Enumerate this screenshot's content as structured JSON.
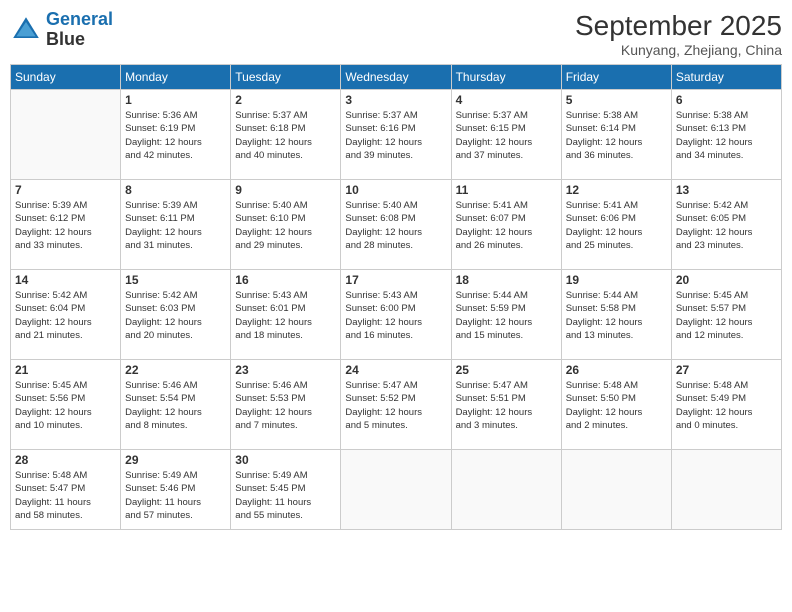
{
  "logo": {
    "line1": "General",
    "line2": "Blue"
  },
  "title": "September 2025",
  "subtitle": "Kunyang, Zhejiang, China",
  "weekdays": [
    "Sunday",
    "Monday",
    "Tuesday",
    "Wednesday",
    "Thursday",
    "Friday",
    "Saturday"
  ],
  "weeks": [
    [
      {
        "day": "",
        "info": ""
      },
      {
        "day": "1",
        "info": "Sunrise: 5:36 AM\nSunset: 6:19 PM\nDaylight: 12 hours\nand 42 minutes."
      },
      {
        "day": "2",
        "info": "Sunrise: 5:37 AM\nSunset: 6:18 PM\nDaylight: 12 hours\nand 40 minutes."
      },
      {
        "day": "3",
        "info": "Sunrise: 5:37 AM\nSunset: 6:16 PM\nDaylight: 12 hours\nand 39 minutes."
      },
      {
        "day": "4",
        "info": "Sunrise: 5:37 AM\nSunset: 6:15 PM\nDaylight: 12 hours\nand 37 minutes."
      },
      {
        "day": "5",
        "info": "Sunrise: 5:38 AM\nSunset: 6:14 PM\nDaylight: 12 hours\nand 36 minutes."
      },
      {
        "day": "6",
        "info": "Sunrise: 5:38 AM\nSunset: 6:13 PM\nDaylight: 12 hours\nand 34 minutes."
      }
    ],
    [
      {
        "day": "7",
        "info": "Sunrise: 5:39 AM\nSunset: 6:12 PM\nDaylight: 12 hours\nand 33 minutes."
      },
      {
        "day": "8",
        "info": "Sunrise: 5:39 AM\nSunset: 6:11 PM\nDaylight: 12 hours\nand 31 minutes."
      },
      {
        "day": "9",
        "info": "Sunrise: 5:40 AM\nSunset: 6:10 PM\nDaylight: 12 hours\nand 29 minutes."
      },
      {
        "day": "10",
        "info": "Sunrise: 5:40 AM\nSunset: 6:08 PM\nDaylight: 12 hours\nand 28 minutes."
      },
      {
        "day": "11",
        "info": "Sunrise: 5:41 AM\nSunset: 6:07 PM\nDaylight: 12 hours\nand 26 minutes."
      },
      {
        "day": "12",
        "info": "Sunrise: 5:41 AM\nSunset: 6:06 PM\nDaylight: 12 hours\nand 25 minutes."
      },
      {
        "day": "13",
        "info": "Sunrise: 5:42 AM\nSunset: 6:05 PM\nDaylight: 12 hours\nand 23 minutes."
      }
    ],
    [
      {
        "day": "14",
        "info": "Sunrise: 5:42 AM\nSunset: 6:04 PM\nDaylight: 12 hours\nand 21 minutes."
      },
      {
        "day": "15",
        "info": "Sunrise: 5:42 AM\nSunset: 6:03 PM\nDaylight: 12 hours\nand 20 minutes."
      },
      {
        "day": "16",
        "info": "Sunrise: 5:43 AM\nSunset: 6:01 PM\nDaylight: 12 hours\nand 18 minutes."
      },
      {
        "day": "17",
        "info": "Sunrise: 5:43 AM\nSunset: 6:00 PM\nDaylight: 12 hours\nand 16 minutes."
      },
      {
        "day": "18",
        "info": "Sunrise: 5:44 AM\nSunset: 5:59 PM\nDaylight: 12 hours\nand 15 minutes."
      },
      {
        "day": "19",
        "info": "Sunrise: 5:44 AM\nSunset: 5:58 PM\nDaylight: 12 hours\nand 13 minutes."
      },
      {
        "day": "20",
        "info": "Sunrise: 5:45 AM\nSunset: 5:57 PM\nDaylight: 12 hours\nand 12 minutes."
      }
    ],
    [
      {
        "day": "21",
        "info": "Sunrise: 5:45 AM\nSunset: 5:56 PM\nDaylight: 12 hours\nand 10 minutes."
      },
      {
        "day": "22",
        "info": "Sunrise: 5:46 AM\nSunset: 5:54 PM\nDaylight: 12 hours\nand 8 minutes."
      },
      {
        "day": "23",
        "info": "Sunrise: 5:46 AM\nSunset: 5:53 PM\nDaylight: 12 hours\nand 7 minutes."
      },
      {
        "day": "24",
        "info": "Sunrise: 5:47 AM\nSunset: 5:52 PM\nDaylight: 12 hours\nand 5 minutes."
      },
      {
        "day": "25",
        "info": "Sunrise: 5:47 AM\nSunset: 5:51 PM\nDaylight: 12 hours\nand 3 minutes."
      },
      {
        "day": "26",
        "info": "Sunrise: 5:48 AM\nSunset: 5:50 PM\nDaylight: 12 hours\nand 2 minutes."
      },
      {
        "day": "27",
        "info": "Sunrise: 5:48 AM\nSunset: 5:49 PM\nDaylight: 12 hours\nand 0 minutes."
      }
    ],
    [
      {
        "day": "28",
        "info": "Sunrise: 5:48 AM\nSunset: 5:47 PM\nDaylight: 11 hours\nand 58 minutes."
      },
      {
        "day": "29",
        "info": "Sunrise: 5:49 AM\nSunset: 5:46 PM\nDaylight: 11 hours\nand 57 minutes."
      },
      {
        "day": "30",
        "info": "Sunrise: 5:49 AM\nSunset: 5:45 PM\nDaylight: 11 hours\nand 55 minutes."
      },
      {
        "day": "",
        "info": ""
      },
      {
        "day": "",
        "info": ""
      },
      {
        "day": "",
        "info": ""
      },
      {
        "day": "",
        "info": ""
      }
    ]
  ]
}
